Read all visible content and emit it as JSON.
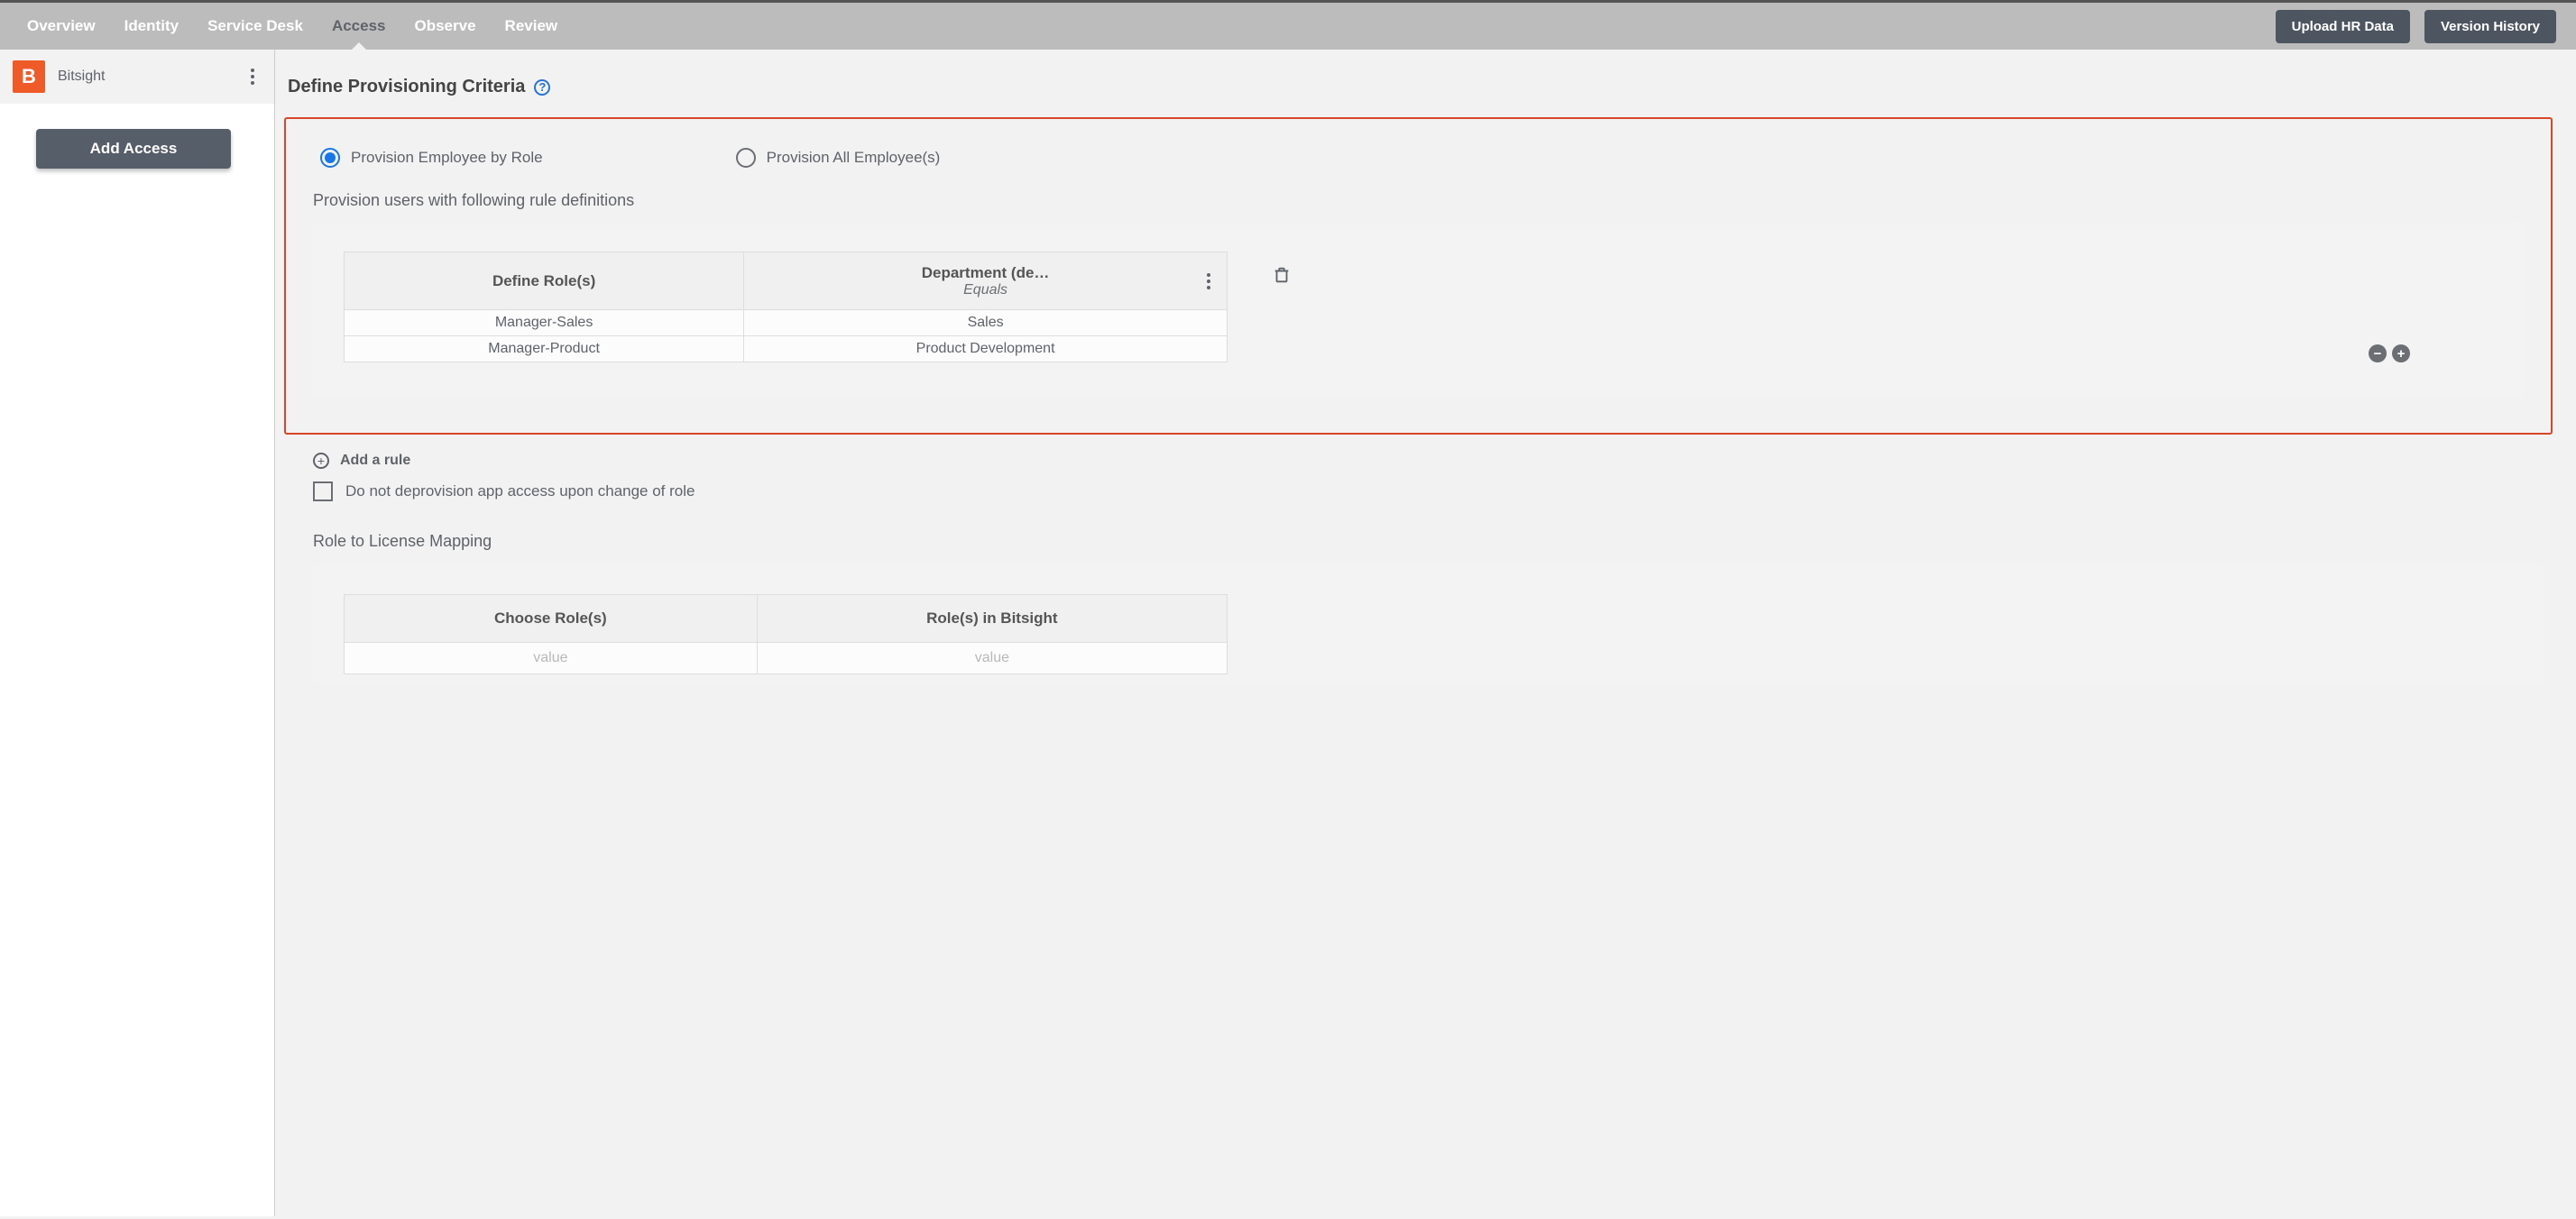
{
  "topnav": {
    "items": [
      {
        "label": "Overview"
      },
      {
        "label": "Identity"
      },
      {
        "label": "Service Desk"
      },
      {
        "label": "Access"
      },
      {
        "label": "Observe"
      },
      {
        "label": "Review"
      }
    ],
    "active_index": 3,
    "actions": {
      "upload": "Upload HR Data",
      "version": "Version History"
    }
  },
  "sidebar": {
    "app_name": "Bitsight",
    "logo_letter": "B",
    "add_button": "Add Access"
  },
  "section": {
    "title": "Define Provisioning Criteria"
  },
  "provision": {
    "options": [
      {
        "label": "Provision Employee by Role",
        "checked": true
      },
      {
        "label": "Provision All Employee(s)",
        "checked": false
      }
    ],
    "rules_heading": "Provision users with following rule definitions",
    "table": {
      "col1_header": "Define Role(s)",
      "col2_header_line1": "Department (de…",
      "col2_header_line2": "Equals",
      "rows": [
        {
          "role": "Manager-Sales",
          "dept": "Sales"
        },
        {
          "role": "Manager-Product",
          "dept": "Product Development"
        }
      ]
    }
  },
  "below": {
    "add_rule": "Add a rule",
    "no_deprovision": "Do not deprovision app access upon change of role"
  },
  "mapping": {
    "title": "Role to License Mapping",
    "col1": "Choose Role(s)",
    "col2": "Role(s) in Bitsight",
    "placeholder": "value"
  }
}
